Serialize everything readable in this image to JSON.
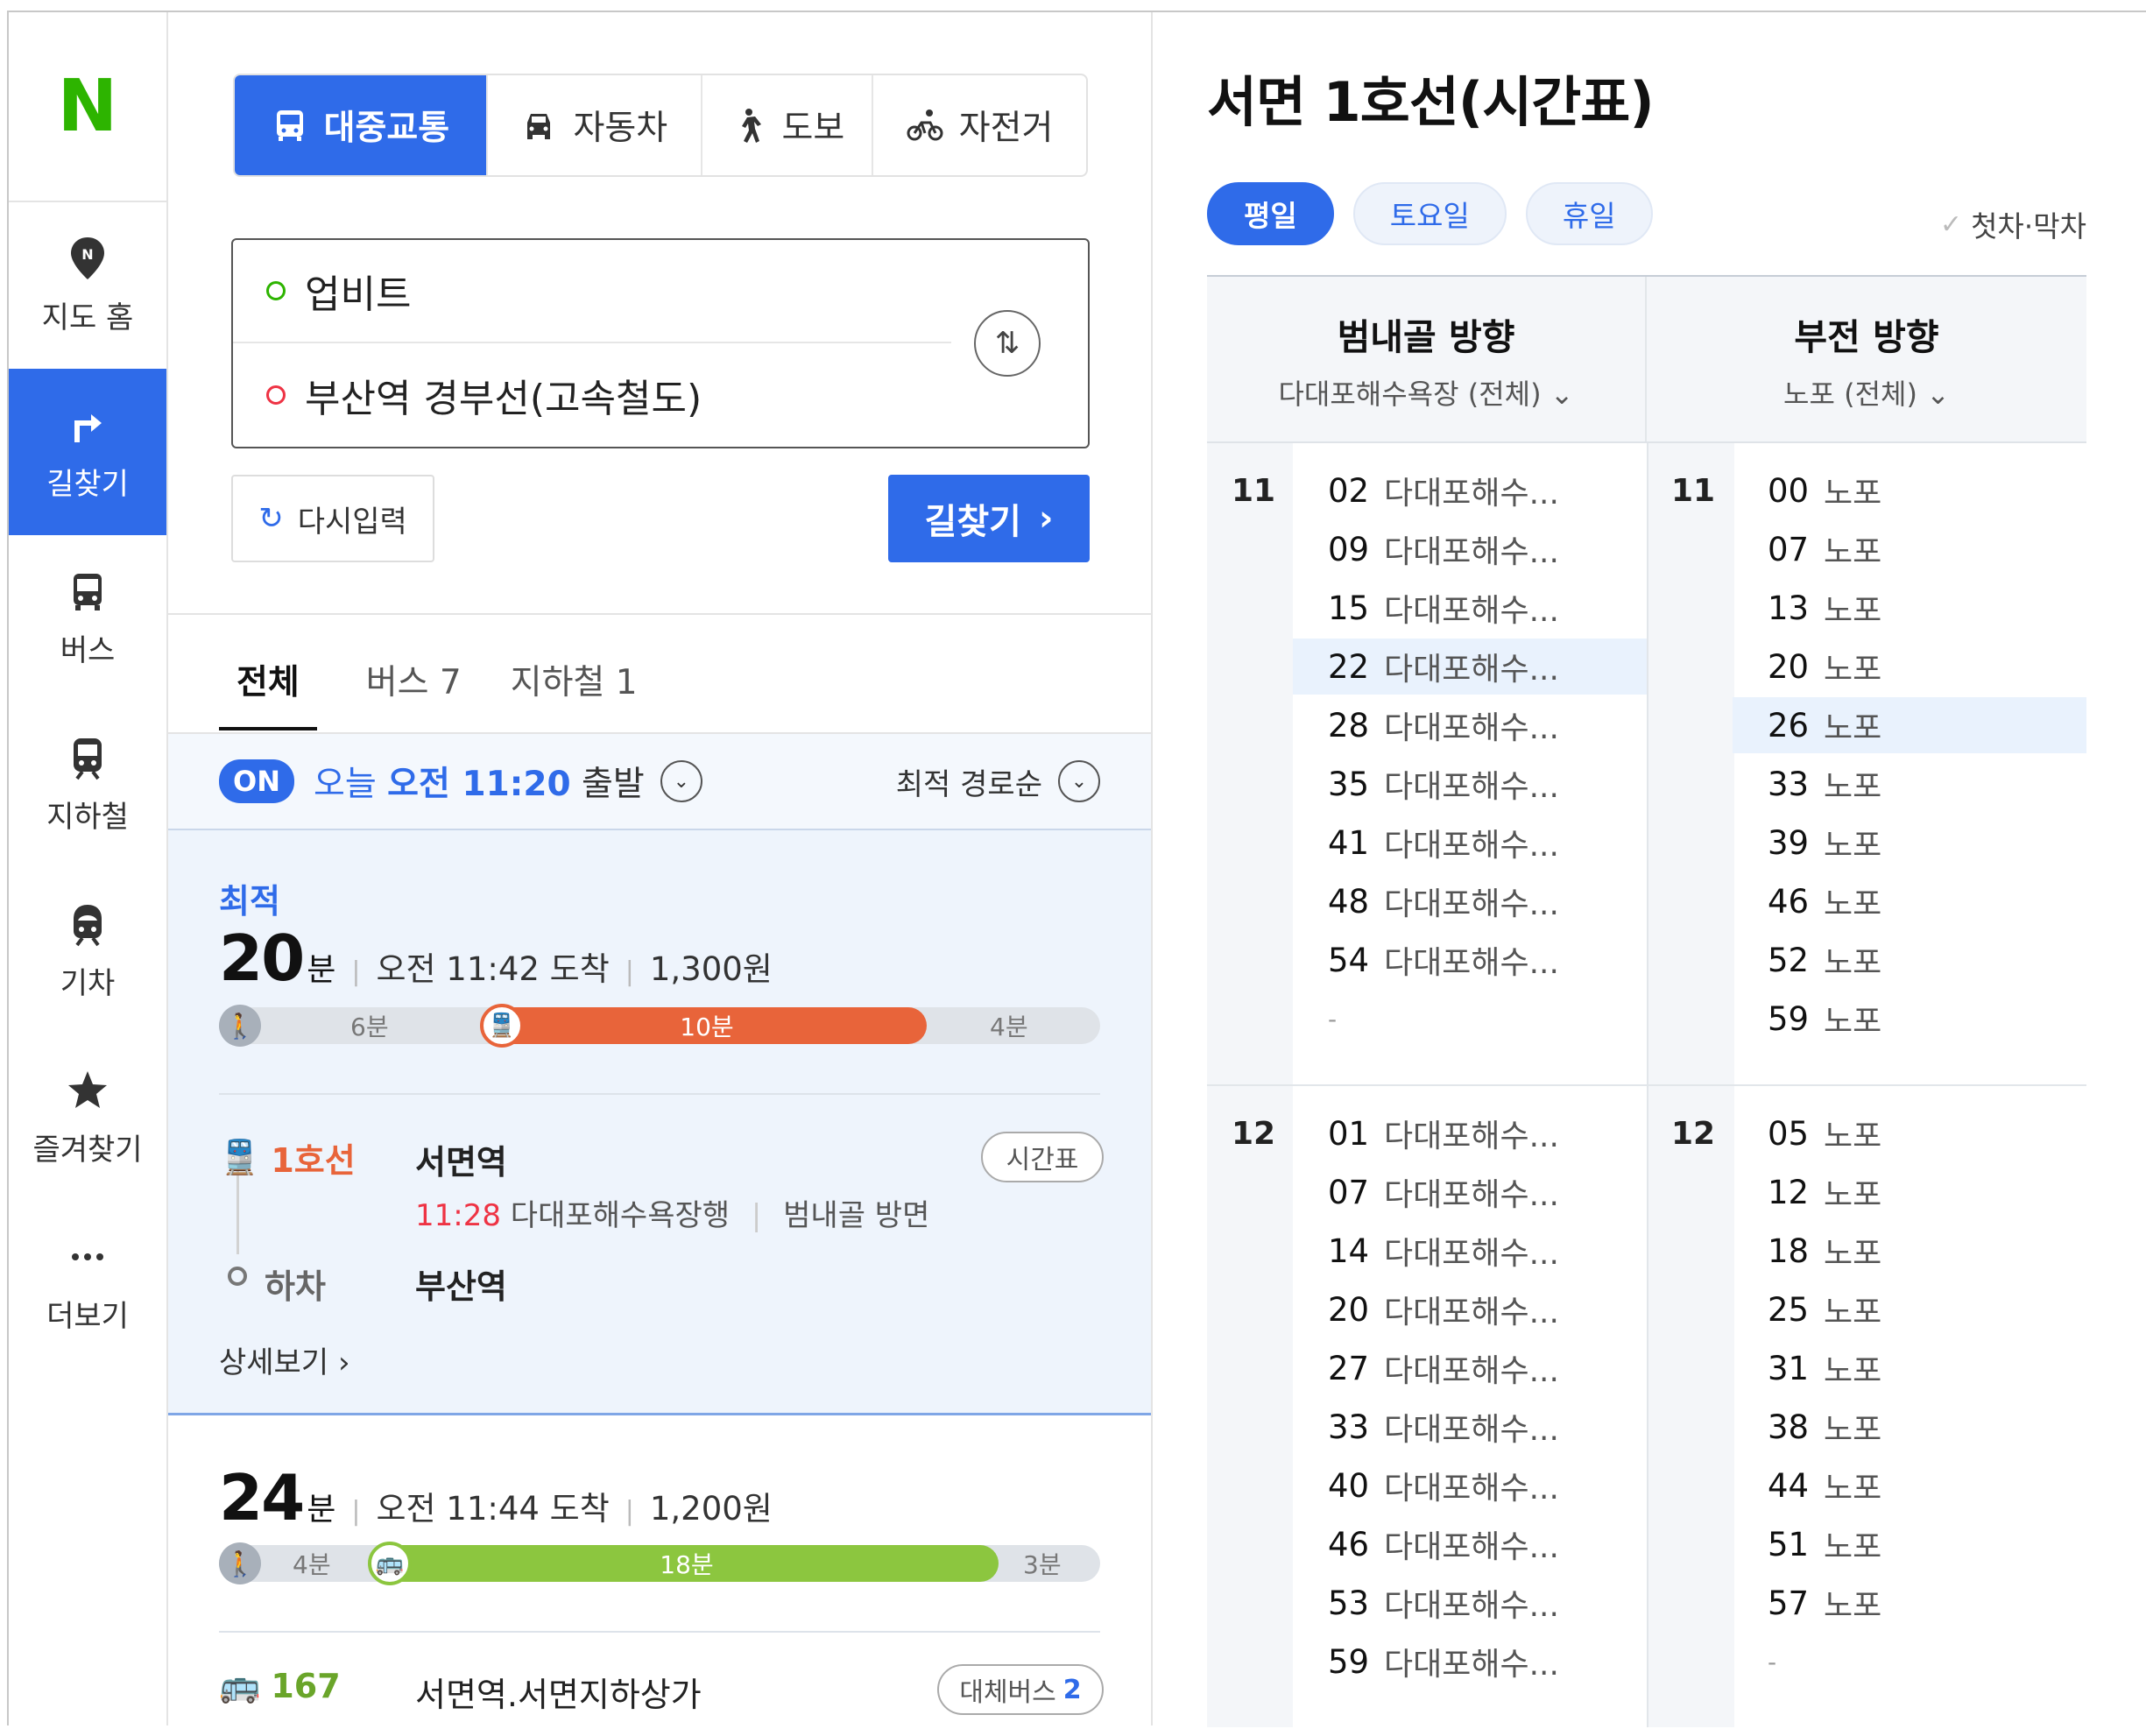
{
  "app": {
    "logo": "N"
  },
  "rail": [
    {
      "label": "지도 홈",
      "icon": "map-pin-icon"
    },
    {
      "label": "길찾기",
      "icon": "directions-arrow-icon",
      "active": true
    },
    {
      "label": "버스",
      "icon": "bus-icon"
    },
    {
      "label": "지하철",
      "icon": "subway-icon"
    },
    {
      "label": "기차",
      "icon": "train-icon"
    },
    {
      "label": "즐겨찾기",
      "icon": "star-icon"
    },
    {
      "label": "더보기",
      "icon": "more-icon"
    }
  ],
  "modes": [
    {
      "label": "대중교통",
      "icon": "bus-icon",
      "active": true
    },
    {
      "label": "자동차",
      "icon": "car-icon"
    },
    {
      "label": "도보",
      "icon": "walk-icon"
    },
    {
      "label": "자전거",
      "icon": "bicycle-icon"
    }
  ],
  "route": {
    "origin": "업비트",
    "destination": "부산역 경부선(고속철도)"
  },
  "buttons": {
    "reset": "다시입력",
    "search": "길찾기"
  },
  "result_tabs": [
    "전체",
    "버스 7",
    "지하철 1"
  ],
  "depart": {
    "badge": "ON",
    "prefix": "오늘",
    "time": "오전 11:20",
    "suffix": "출발",
    "sort": "최적 경로순"
  },
  "results": [
    {
      "tag": "최적",
      "minutes": "20",
      "unit": "분",
      "arrival": "오전 11:42 도착",
      "fare": "1,300원",
      "segments": {
        "walk1": "6분",
        "ride": "10분",
        "walk2": "4분"
      },
      "ride_fraction": 0.5,
      "ride_color": "#e8643a",
      "line": "1호선",
      "board_station": "서면역",
      "timetable_btn": "시간표",
      "next_time": "11:28",
      "headsign": "다대포해수욕장행",
      "direction": "범내골 방면",
      "alight_label": "하차",
      "alight_station": "부산역",
      "detail": "상세보기"
    },
    {
      "minutes": "24",
      "unit": "분",
      "arrival": "오전 11:44 도착",
      "fare": "1,200원",
      "segments": {
        "walk1": "4분",
        "ride": "18분",
        "walk2": "3분"
      },
      "ride_color": "#8cc63f",
      "line": "167",
      "board_station": "서면역.서면지하상가",
      "alt_btn": "대체버스",
      "alt_count": "2"
    }
  ],
  "timetable": {
    "title": "서면 1호선(시간표)",
    "days": [
      "평일",
      "토요일",
      "휴일"
    ],
    "first_last": "첫차·막차",
    "directions": [
      {
        "name": "범내골 방향",
        "dest": "다대포해수욕장 (전체)"
      },
      {
        "name": "부전 방향",
        "dest": "노포 (전체)"
      }
    ],
    "hours": [
      {
        "hour": "11",
        "left": [
          {
            "m": "02",
            "d": "다대포해수..."
          },
          {
            "m": "09",
            "d": "다대포해수..."
          },
          {
            "m": "15",
            "d": "다대포해수..."
          },
          {
            "m": "22",
            "d": "다대포해수..."
          },
          {
            "m": "28",
            "d": "다대포해수..."
          },
          {
            "m": "35",
            "d": "다대포해수..."
          },
          {
            "m": "41",
            "d": "다대포해수..."
          },
          {
            "m": "48",
            "d": "다대포해수..."
          },
          {
            "m": "54",
            "d": "다대포해수..."
          },
          {
            "m": "-",
            "d": ""
          }
        ],
        "right": [
          {
            "m": "00",
            "d": "노포"
          },
          {
            "m": "07",
            "d": "노포"
          },
          {
            "m": "13",
            "d": "노포"
          },
          {
            "m": "20",
            "d": "노포"
          },
          {
            "m": "26",
            "d": "노포"
          },
          {
            "m": "33",
            "d": "노포"
          },
          {
            "m": "39",
            "d": "노포"
          },
          {
            "m": "46",
            "d": "노포"
          },
          {
            "m": "52",
            "d": "노포"
          },
          {
            "m": "59",
            "d": "노포"
          }
        ]
      },
      {
        "hour": "12",
        "left": [
          {
            "m": "01",
            "d": "다대포해수..."
          },
          {
            "m": "07",
            "d": "다대포해수..."
          },
          {
            "m": "14",
            "d": "다대포해수..."
          },
          {
            "m": "20",
            "d": "다대포해수..."
          },
          {
            "m": "27",
            "d": "다대포해수..."
          },
          {
            "m": "33",
            "d": "다대포해수..."
          },
          {
            "m": "40",
            "d": "다대포해수..."
          },
          {
            "m": "46",
            "d": "다대포해수..."
          },
          {
            "m": "53",
            "d": "다대포해수..."
          },
          {
            "m": "59",
            "d": "다대포해수..."
          }
        ],
        "right": [
          {
            "m": "05",
            "d": "노포"
          },
          {
            "m": "12",
            "d": "노포"
          },
          {
            "m": "18",
            "d": "노포"
          },
          {
            "m": "25",
            "d": "노포"
          },
          {
            "m": "31",
            "d": "노포"
          },
          {
            "m": "38",
            "d": "노포"
          },
          {
            "m": "44",
            "d": "노포"
          },
          {
            "m": "51",
            "d": "노포"
          },
          {
            "m": "57",
            "d": "노포"
          },
          {
            "m": "-",
            "d": ""
          }
        ]
      }
    ],
    "highlight": {
      "left": {
        "hour": 0,
        "row": 3
      },
      "right": {
        "hour": 0,
        "row": 4
      }
    }
  }
}
